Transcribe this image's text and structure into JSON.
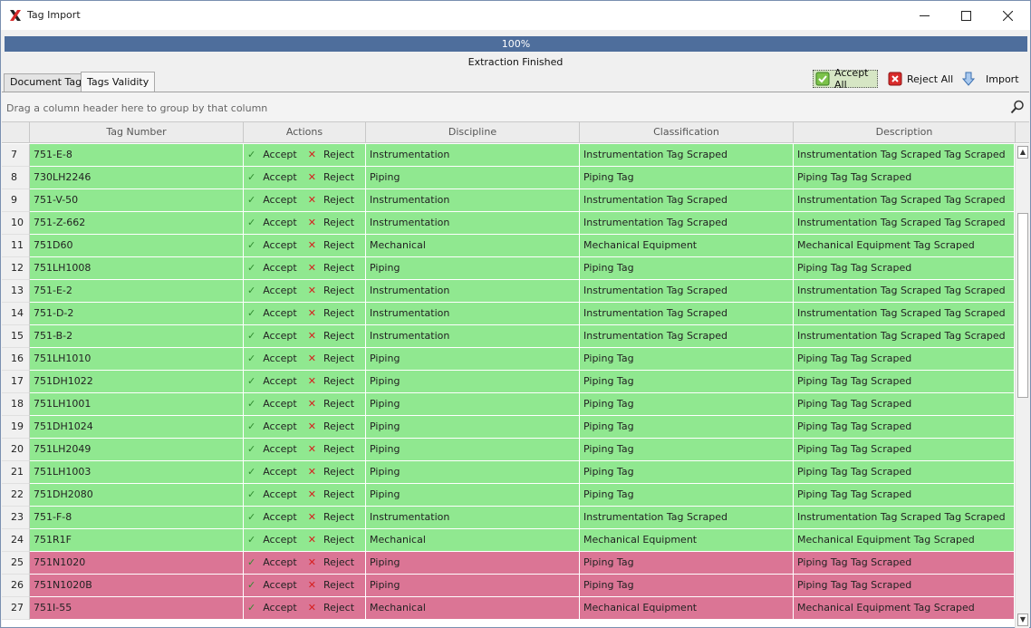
{
  "window": {
    "title": "Tag Import"
  },
  "progress": {
    "label": "100%",
    "value": 100,
    "status": "Extraction Finished"
  },
  "tabs": [
    {
      "label": "Document Tags"
    },
    {
      "label": "Tags Validity"
    }
  ],
  "toolbar": {
    "accept_all": "Accept All",
    "reject_all": "Reject All",
    "import": "Import"
  },
  "grid": {
    "group_hint": "Drag a column header here to group by that column",
    "columns": [
      "Tag Number",
      "Actions",
      "Discipline",
      "Classification",
      "Description"
    ],
    "accept_label": "Accept",
    "reject_label": "Reject",
    "rows": [
      {
        "num": "7",
        "tag": "751-E-8",
        "discipline": "Instrumentation",
        "classification": "Instrumentation Tag Scraped",
        "description": "Instrumentation Tag Scraped Tag Scraped",
        "status": "green"
      },
      {
        "num": "8",
        "tag": "730LH2246",
        "discipline": "Piping",
        "classification": "Piping Tag",
        "description": "Piping Tag Tag Scraped",
        "status": "green"
      },
      {
        "num": "9",
        "tag": "751-V-50",
        "discipline": "Instrumentation",
        "classification": "Instrumentation Tag Scraped",
        "description": "Instrumentation Tag Scraped Tag Scraped",
        "status": "green"
      },
      {
        "num": "10",
        "tag": "751-Z-662",
        "discipline": "Instrumentation",
        "classification": "Instrumentation Tag Scraped",
        "description": "Instrumentation Tag Scraped Tag Scraped",
        "status": "green"
      },
      {
        "num": "11",
        "tag": "751D60",
        "discipline": "Mechanical",
        "classification": "Mechanical Equipment",
        "description": "Mechanical Equipment Tag Scraped",
        "status": "green"
      },
      {
        "num": "12",
        "tag": "751LH1008",
        "discipline": "Piping",
        "classification": "Piping Tag",
        "description": "Piping Tag Tag Scraped",
        "status": "green"
      },
      {
        "num": "13",
        "tag": "751-E-2",
        "discipline": "Instrumentation",
        "classification": "Instrumentation Tag Scraped",
        "description": "Instrumentation Tag Scraped Tag Scraped",
        "status": "green"
      },
      {
        "num": "14",
        "tag": "751-D-2",
        "discipline": "Instrumentation",
        "classification": "Instrumentation Tag Scraped",
        "description": "Instrumentation Tag Scraped Tag Scraped",
        "status": "green"
      },
      {
        "num": "15",
        "tag": "751-B-2",
        "discipline": "Instrumentation",
        "classification": "Instrumentation Tag Scraped",
        "description": "Instrumentation Tag Scraped Tag Scraped",
        "status": "green"
      },
      {
        "num": "16",
        "tag": "751LH1010",
        "discipline": "Piping",
        "classification": "Piping Tag",
        "description": "Piping Tag Tag Scraped",
        "status": "green"
      },
      {
        "num": "17",
        "tag": "751DH1022",
        "discipline": "Piping",
        "classification": "Piping Tag",
        "description": "Piping Tag Tag Scraped",
        "status": "green"
      },
      {
        "num": "18",
        "tag": "751LH1001",
        "discipline": "Piping",
        "classification": "Piping Tag",
        "description": "Piping Tag Tag Scraped",
        "status": "green"
      },
      {
        "num": "19",
        "tag": "751DH1024",
        "discipline": "Piping",
        "classification": "Piping Tag",
        "description": "Piping Tag Tag Scraped",
        "status": "green"
      },
      {
        "num": "20",
        "tag": "751LH2049",
        "discipline": "Piping",
        "classification": "Piping Tag",
        "description": "Piping Tag Tag Scraped",
        "status": "green"
      },
      {
        "num": "21",
        "tag": "751LH1003",
        "discipline": "Piping",
        "classification": "Piping Tag",
        "description": "Piping Tag Tag Scraped",
        "status": "green"
      },
      {
        "num": "22",
        "tag": "751DH2080",
        "discipline": "Piping",
        "classification": "Piping Tag",
        "description": "Piping Tag Tag Scraped",
        "status": "green"
      },
      {
        "num": "23",
        "tag": "751-F-8",
        "discipline": "Instrumentation",
        "classification": "Instrumentation Tag Scraped",
        "description": "Instrumentation Tag Scraped Tag Scraped",
        "status": "green"
      },
      {
        "num": "24",
        "tag": "751R1F",
        "discipline": "Mechanical",
        "classification": "Mechanical Equipment",
        "description": "Mechanical Equipment Tag Scraped",
        "status": "green"
      },
      {
        "num": "25",
        "tag": "751N1020",
        "discipline": "Piping",
        "classification": "Piping Tag",
        "description": "Piping Tag Tag Scraped",
        "status": "red"
      },
      {
        "num": "26",
        "tag": "751N1020B",
        "discipline": "Piping",
        "classification": "Piping Tag",
        "description": "Piping Tag Tag Scraped",
        "status": "red"
      },
      {
        "num": "27",
        "tag": "751I-55",
        "discipline": "Mechanical",
        "classification": "Mechanical Equipment",
        "description": "Mechanical Equipment Tag Scraped",
        "status": "red"
      }
    ]
  },
  "colors": {
    "valid_row": "#90e890",
    "invalid_row": "#db7595",
    "progress_bar": "#4e6e9c"
  }
}
